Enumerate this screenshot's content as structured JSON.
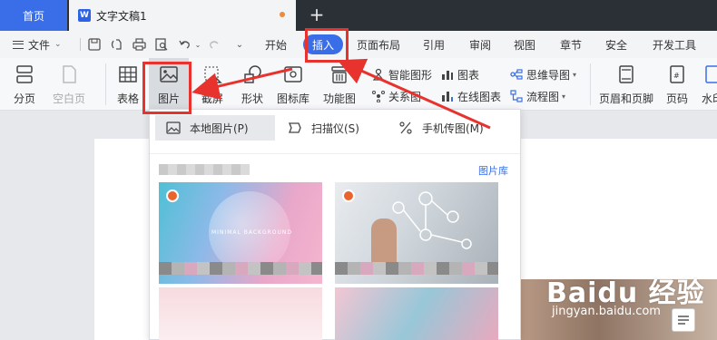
{
  "tabs": {
    "home": "首页",
    "doc_title": "文字文稿1",
    "doc_icon": "W",
    "add": "+"
  },
  "menu": {
    "file": "文件",
    "items": [
      "开始",
      "插入",
      "页面布局",
      "引用",
      "审阅",
      "视图",
      "章节",
      "安全",
      "开发工具"
    ]
  },
  "ribbon": {
    "paging": "分页",
    "blank_page": "空白页",
    "table": "表格",
    "picture": "图片",
    "screenshot": "截屏",
    "shapes": "形状",
    "icon_lib": "图标库",
    "func_chart": "功能图",
    "smart_graphic": "智能图形",
    "chart": "图表",
    "mind_map": "思维导图",
    "relation_map": "关系图",
    "online_chart": "在线图表",
    "flowchart": "流程图",
    "header_footer": "页眉和页脚",
    "page_number": "页码",
    "watermark": "水印"
  },
  "picture_menu": {
    "local": "本地图片(P)",
    "scanner": "扫描仪(S)",
    "phone": "手机传图(M)",
    "library": "图片库",
    "thumb1_text": "MINIMAL BACKGROUND"
  },
  "watermark_overlay": {
    "main": "Baidu 经验",
    "sub": "jingyan.baidu.com"
  },
  "colors": {
    "accent": "#3a6ee8",
    "annotation": "#e8322e",
    "tabbar": "#2b2f36"
  }
}
